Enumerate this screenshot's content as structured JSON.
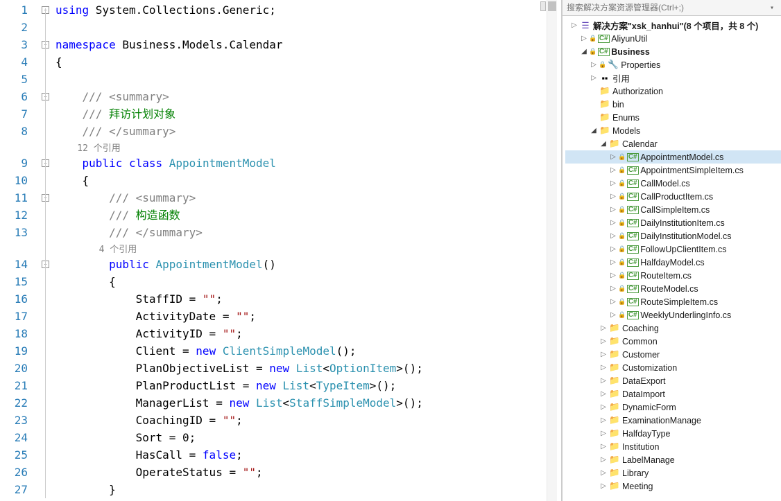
{
  "editor": {
    "lines": [
      {
        "n": "1",
        "type": "code",
        "html": "<span class='kw'>using</span> System.Collections.Generic;",
        "fold": "-"
      },
      {
        "n": "2",
        "type": "code",
        "html": ""
      },
      {
        "n": "3",
        "type": "code",
        "html": "<span class='kw'>namespace</span> Business.Models.Calendar",
        "fold": "-"
      },
      {
        "n": "4",
        "type": "code",
        "html": "{"
      },
      {
        "n": "5",
        "type": "code",
        "html": ""
      },
      {
        "n": "6",
        "type": "code",
        "html": "    <span class='com'>/// &lt;summary&gt;</span>",
        "fold": "-"
      },
      {
        "n": "7",
        "type": "code",
        "html": "    <span class='com'>///</span> <span class='comgreen'>拜访计划对象</span>"
      },
      {
        "n": "8",
        "type": "code",
        "html": "    <span class='com'>/// &lt;/summary&gt;</span>"
      },
      {
        "n": "",
        "type": "ref",
        "html": "    12 个引用"
      },
      {
        "n": "9",
        "type": "code",
        "html": "    <span class='kw'>public</span> <span class='kw'>class</span> <span class='cls'>AppointmentModel</span>",
        "fold": "-"
      },
      {
        "n": "10",
        "type": "code",
        "html": "    {"
      },
      {
        "n": "11",
        "type": "code",
        "html": "        <span class='com'>/// &lt;summary&gt;</span>",
        "fold": "-"
      },
      {
        "n": "12",
        "type": "code",
        "html": "        <span class='com'>///</span> <span class='comgreen'>构造函数</span>"
      },
      {
        "n": "13",
        "type": "code",
        "html": "        <span class='com'>/// &lt;/summary&gt;</span>"
      },
      {
        "n": "",
        "type": "ref",
        "html": "        4 个引用"
      },
      {
        "n": "14",
        "type": "code",
        "html": "        <span class='kw'>public</span> <span class='cls'>AppointmentModel</span>()",
        "fold": "-"
      },
      {
        "n": "15",
        "type": "code",
        "html": "        {"
      },
      {
        "n": "16",
        "type": "code",
        "html": "            StaffID = <span class='str'>&quot;&quot;</span>;"
      },
      {
        "n": "17",
        "type": "code",
        "html": "            ActivityDate = <span class='str'>&quot;&quot;</span>;"
      },
      {
        "n": "18",
        "type": "code",
        "html": "            ActivityID = <span class='str'>&quot;&quot;</span>;"
      },
      {
        "n": "19",
        "type": "code",
        "html": "            Client = <span class='kw'>new</span> <span class='cls'>ClientSimpleModel</span>();"
      },
      {
        "n": "20",
        "type": "code",
        "html": "            PlanObjectiveList = <span class='kw'>new</span> <span class='cls'>List</span>&lt;<span class='cls'>OptionItem</span>&gt;();"
      },
      {
        "n": "21",
        "type": "code",
        "html": "            PlanProductList = <span class='kw'>new</span> <span class='cls'>List</span>&lt;<span class='cls'>TypeItem</span>&gt;();"
      },
      {
        "n": "22",
        "type": "code",
        "html": "            ManagerList = <span class='kw'>new</span> <span class='cls'>List</span>&lt;<span class='cls'>StaffSimpleModel</span>&gt;();"
      },
      {
        "n": "23",
        "type": "code",
        "html": "            CoachingID = <span class='str'>&quot;&quot;</span>;"
      },
      {
        "n": "24",
        "type": "code",
        "html": "            Sort = 0;"
      },
      {
        "n": "25",
        "type": "code",
        "html": "            HasCall = <span class='kw'>false</span>;"
      },
      {
        "n": "26",
        "type": "code",
        "html": "            OperateStatus = <span class='str'>&quot;&quot;</span>;"
      },
      {
        "n": "27",
        "type": "code",
        "html": "        }"
      }
    ]
  },
  "explorer": {
    "search_placeholder": "搜索解决方案资源管理器(Ctrl+;)",
    "solution_label": "解决方案\"xsk_hanhui\"(8 个项目，共 8 个)",
    "tree": [
      {
        "d": 0,
        "exp": "c",
        "ico": "sln",
        "label": "__SOLUTION__",
        "bold": true
      },
      {
        "d": 1,
        "exp": "c",
        "ico": "proj",
        "lock": true,
        "label": "AliyunUtil"
      },
      {
        "d": 1,
        "exp": "o",
        "ico": "proj",
        "lock": true,
        "label": "Business",
        "bold": true
      },
      {
        "d": 2,
        "exp": "c",
        "ico": "prop",
        "lock": true,
        "label": "Properties"
      },
      {
        "d": 2,
        "exp": "c",
        "ico": "ref",
        "label": "引用"
      },
      {
        "d": 2,
        "exp": "n",
        "ico": "folder",
        "label": "Authorization"
      },
      {
        "d": 2,
        "exp": "n",
        "ico": "folder",
        "label": "bin"
      },
      {
        "d": 2,
        "exp": "n",
        "ico": "folder",
        "label": "Enums"
      },
      {
        "d": 2,
        "exp": "o",
        "ico": "folder",
        "label": "Models"
      },
      {
        "d": 3,
        "exp": "o",
        "ico": "folder",
        "label": "Calendar"
      },
      {
        "d": 4,
        "exp": "c",
        "ico": "cs",
        "lock": true,
        "label": "AppointmentModel.cs",
        "sel": true
      },
      {
        "d": 4,
        "exp": "c",
        "ico": "cs",
        "lock": true,
        "label": "AppointmentSimpleItem.cs"
      },
      {
        "d": 4,
        "exp": "c",
        "ico": "cs",
        "lock": true,
        "label": "CallModel.cs"
      },
      {
        "d": 4,
        "exp": "c",
        "ico": "cs",
        "lock": true,
        "label": "CallProductItem.cs"
      },
      {
        "d": 4,
        "exp": "c",
        "ico": "cs",
        "lock": true,
        "label": "CallSimpleItem.cs"
      },
      {
        "d": 4,
        "exp": "c",
        "ico": "cs",
        "lock": true,
        "label": "DailyInstitutionItem.cs"
      },
      {
        "d": 4,
        "exp": "c",
        "ico": "cs",
        "lock": true,
        "label": "DailyInstitutionModel.cs"
      },
      {
        "d": 4,
        "exp": "c",
        "ico": "cs",
        "lock": true,
        "label": "FollowUpClientItem.cs"
      },
      {
        "d": 4,
        "exp": "c",
        "ico": "cs",
        "lock": true,
        "label": "HalfdayModel.cs"
      },
      {
        "d": 4,
        "exp": "c",
        "ico": "cs",
        "lock": true,
        "label": "RouteItem.cs"
      },
      {
        "d": 4,
        "exp": "c",
        "ico": "cs",
        "lock": true,
        "label": "RouteModel.cs"
      },
      {
        "d": 4,
        "exp": "c",
        "ico": "cs",
        "lock": true,
        "label": "RouteSimpleItem.cs"
      },
      {
        "d": 4,
        "exp": "c",
        "ico": "cs",
        "lock": true,
        "label": "WeeklyUnderlingInfo.cs"
      },
      {
        "d": 3,
        "exp": "c",
        "ico": "folder",
        "label": "Coaching"
      },
      {
        "d": 3,
        "exp": "c",
        "ico": "folder",
        "label": "Common"
      },
      {
        "d": 3,
        "exp": "c",
        "ico": "folder",
        "label": "Customer"
      },
      {
        "d": 3,
        "exp": "c",
        "ico": "folder",
        "label": "Customization"
      },
      {
        "d": 3,
        "exp": "c",
        "ico": "folder",
        "label": "DataExport"
      },
      {
        "d": 3,
        "exp": "c",
        "ico": "folder",
        "label": "DataImport"
      },
      {
        "d": 3,
        "exp": "c",
        "ico": "folder",
        "label": "DynamicForm"
      },
      {
        "d": 3,
        "exp": "c",
        "ico": "folder",
        "label": "ExaminationManage"
      },
      {
        "d": 3,
        "exp": "c",
        "ico": "folder",
        "label": "HalfdayType"
      },
      {
        "d": 3,
        "exp": "c",
        "ico": "folder",
        "label": "Institution"
      },
      {
        "d": 3,
        "exp": "c",
        "ico": "folder",
        "label": "LabelManage"
      },
      {
        "d": 3,
        "exp": "c",
        "ico": "folder",
        "label": "Library"
      },
      {
        "d": 3,
        "exp": "c",
        "ico": "folder",
        "label": "Meeting"
      }
    ]
  }
}
